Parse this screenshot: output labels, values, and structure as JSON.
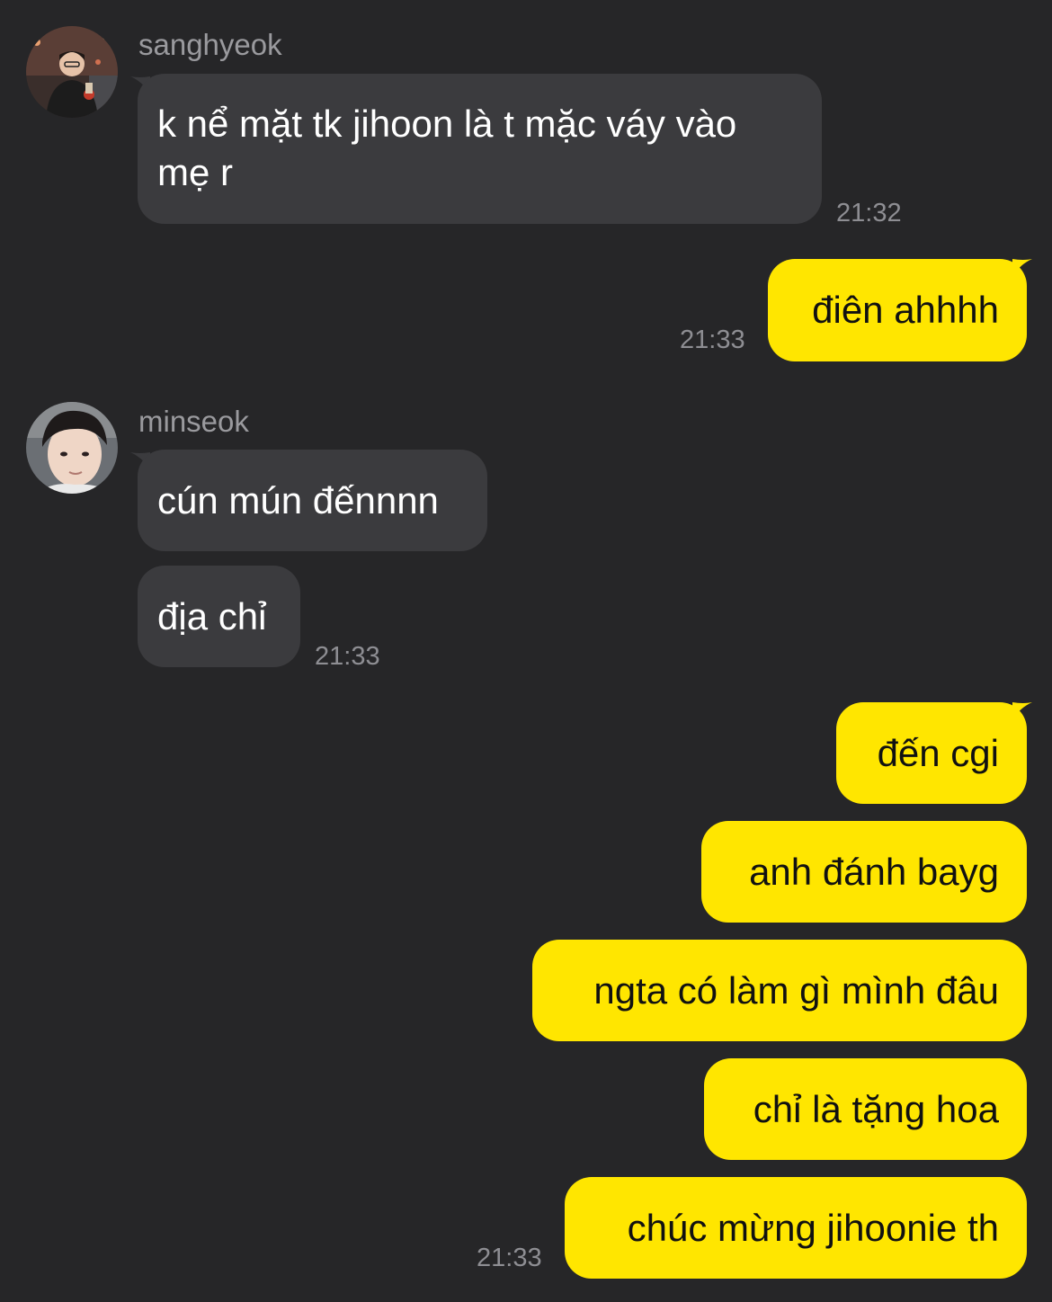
{
  "messages": [
    {
      "sender": "sanghyeok",
      "text": "k nể mặt tk jihoon là t mặc váy vào mẹ r",
      "time": "21:32"
    },
    {
      "text": "điên ahhhh",
      "time": "21:33"
    },
    {
      "sender": "minseok",
      "text1": "cún mún đếnnnn",
      "text2": "địa chỉ",
      "time": "21:33"
    },
    {
      "texts": [
        "đến cgi",
        "anh đánh bayg",
        "ngta có làm gì mình đâu",
        "chỉ là tặng hoa",
        "chúc mừng jihoonie th"
      ],
      "time": "21:33"
    }
  ],
  "colors": {
    "background": "#262628",
    "incoming_bubble": "#3b3b3e",
    "outgoing_bubble": "#ffe600",
    "timestamp": "#8e8e93"
  }
}
